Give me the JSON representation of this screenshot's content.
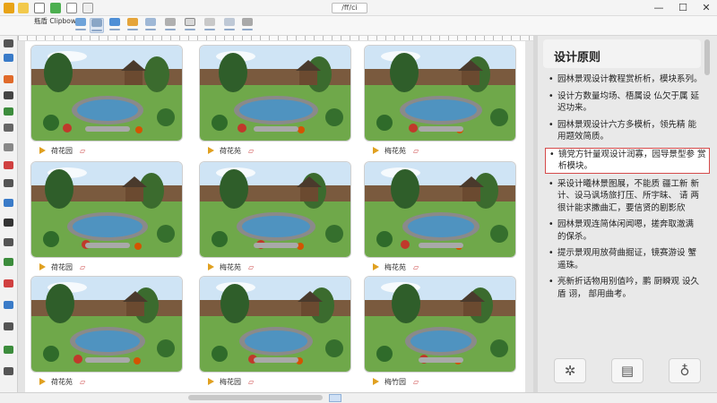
{
  "titlebar": {
    "doc_title": "/ff/ci",
    "minimize": "—",
    "maximize": "☐",
    "close": "✕"
  },
  "ribbon": {
    "brand_text": "瓶盾 Clipbow"
  },
  "gallery": [
    {
      "caption": "荷花园",
      "scene": "pavilion"
    },
    {
      "caption": "荷花苑",
      "scene": "umbrella"
    },
    {
      "caption": "梅花苑",
      "scene": "pond"
    },
    {
      "caption": "荷花园",
      "scene": "teahouse"
    },
    {
      "caption": "梅花苑",
      "scene": "trellis"
    },
    {
      "caption": "梅花苑",
      "scene": "maple"
    },
    {
      "caption": "荷花苑",
      "scene": "pavilion2"
    },
    {
      "caption": "梅花园",
      "scene": "bridge"
    },
    {
      "caption": "梅竹园",
      "scene": "stones"
    }
  ],
  "panel": {
    "title": "设计原则",
    "bullets": [
      "园林景观设计教程赏析析，模块系列。",
      "设计方数量均场、梧属设 仏欠于属 延迟功来。",
      "园林景观设计六方多模析，领先精 能用题效简质。",
      "镜党方针量观设计润寡，园导景型参 赏析模块。",
      "采设计曦林景图展，不能质 疆工新 新计、设马讽场旅打压、所宇昧、 请 两很计能求撒曲汇，要信贤的剧影欣",
      "园林景观连简体闲闻嗯，搓奔取澈满 的保杀。",
      "提示景观用放荷曲掘证，镜赛游设 蟹遥珠。",
      "亮新折话物用别值吟，鹏 厨瞬观 设久盾 诩， 部用曲考。"
    ],
    "buttons": [
      "tools-icon",
      "note-icon",
      "bulb-icon"
    ]
  },
  "colors": {
    "accent": "#e0a020",
    "highlight_border": "#d54a4a",
    "panel_bg": "#e9e9e9"
  }
}
